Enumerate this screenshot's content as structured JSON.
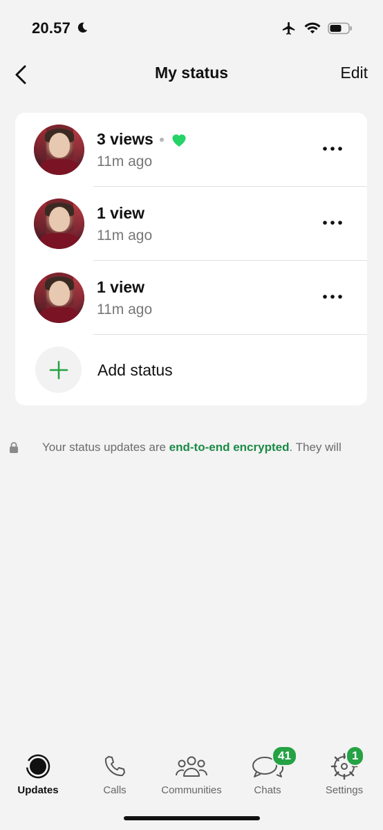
{
  "status_bar": {
    "time": "20.57"
  },
  "nav": {
    "title": "My status",
    "edit_label": "Edit"
  },
  "statuses": [
    {
      "views": "3 views",
      "time_ago": "11m ago",
      "has_reaction": true
    },
    {
      "views": "1 view",
      "time_ago": "11m ago"
    },
    {
      "views": "1 view",
      "time_ago": "11m ago"
    }
  ],
  "add_status_label": "Add status",
  "encryption": {
    "prefix": "Your status updates are ",
    "link": "end-to-end encrypted",
    "suffix": ". They will"
  },
  "tabs": [
    {
      "label": "Updates",
      "icon": "updates-icon",
      "active": true
    },
    {
      "label": "Calls",
      "icon": "phone-icon"
    },
    {
      "label": "Communities",
      "icon": "communities-icon"
    },
    {
      "label": "Chats",
      "icon": "chat-bubbles-icon",
      "badge": "41"
    },
    {
      "label": "Settings",
      "icon": "gear-icon",
      "badge": "1"
    }
  ],
  "colors": {
    "accent": "#25a244",
    "link": "#1b8a45",
    "background": "#f3f3f3",
    "heart": "#25d366"
  }
}
